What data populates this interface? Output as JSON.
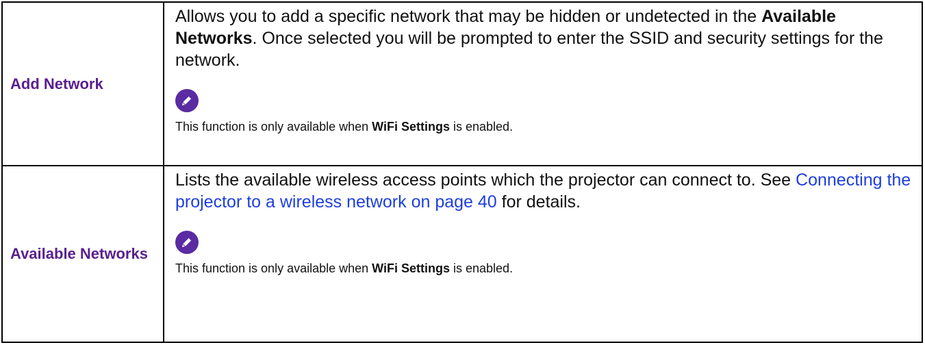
{
  "rows": [
    {
      "term": "Add Network",
      "description": {
        "part1": "Allows you to add a specific network that may be hidden or undetected in the ",
        "bold": "Available Networks",
        "part2": ". Once selected you will be prompted to enter the SSID and security settings for the network."
      },
      "note": {
        "icon": "pencil-note-icon",
        "before": "This function is only available when ",
        "bold": "WiFi Settings",
        "after": " is enabled."
      }
    },
    {
      "term": "Available Networks",
      "description": {
        "part1": "Lists the available wireless access points which the projector can connect to. See ",
        "link": "Connecting the projector to a wireless network on page 40",
        "part2": " for details."
      },
      "note": {
        "icon": "pencil-note-icon",
        "before": "This function is only available when ",
        "bold": "WiFi Settings",
        "after": " is enabled."
      }
    }
  ],
  "colors": {
    "term": "#5a1f8f",
    "link": "#1e3fe0",
    "icon_bg": "#5a2ba1"
  }
}
